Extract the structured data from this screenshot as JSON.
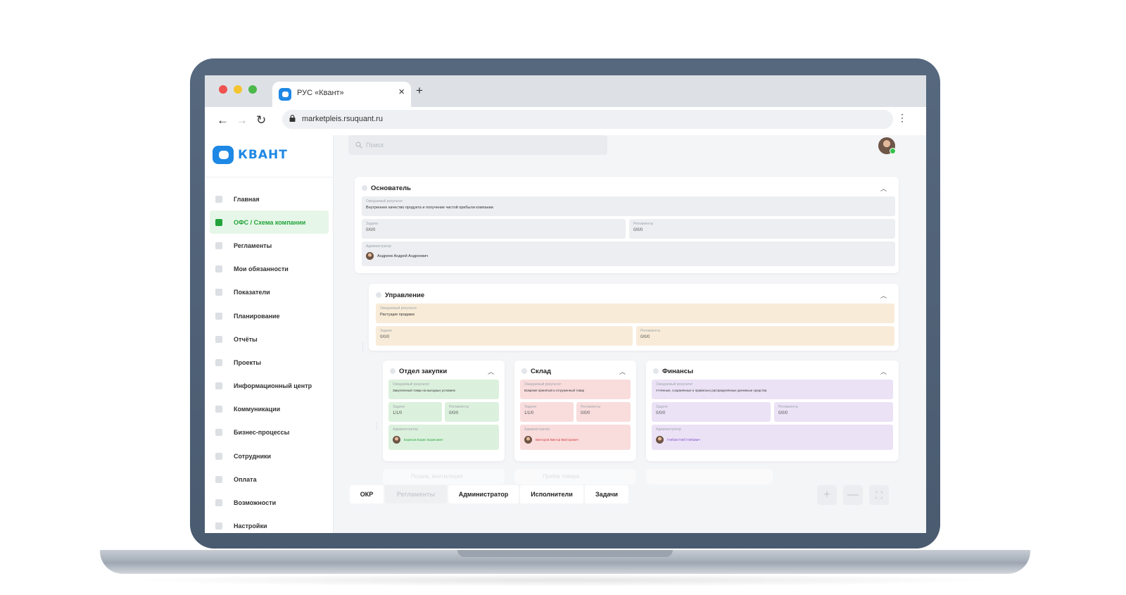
{
  "browser": {
    "tab_title": "РУС «Квант»",
    "tab_close": "×",
    "new_tab": "+",
    "url": "marketpleis.rsuquant.ru",
    "back": "←",
    "forward": "→",
    "reload": "↻",
    "menu": "⋮"
  },
  "app": {
    "logo_text": "КВАНТ",
    "search_placeholder": "Поиск"
  },
  "sidebar": {
    "items": [
      {
        "label": "Главная",
        "icon": "home-icon"
      },
      {
        "label": "ОФС / Схема компании",
        "icon": "structure-icon"
      },
      {
        "label": "Регламенты",
        "icon": "document-icon"
      },
      {
        "label": "Мои обязанности",
        "icon": "duties-icon"
      },
      {
        "label": "Показатели",
        "icon": "metrics-icon"
      },
      {
        "label": "Планирование",
        "icon": "planning-icon"
      },
      {
        "label": "Отчёты",
        "icon": "reports-icon"
      },
      {
        "label": "Проекты",
        "icon": "projects-icon"
      },
      {
        "label": "Информационный центр",
        "icon": "info-icon"
      },
      {
        "label": "Коммуникации",
        "icon": "chat-icon"
      },
      {
        "label": "Бизнес-процессы",
        "icon": "process-icon"
      },
      {
        "label": "Сотрудники",
        "icon": "people-icon"
      },
      {
        "label": "Оплата",
        "icon": "payment-icon"
      },
      {
        "label": "Возможности",
        "icon": "flag-icon"
      },
      {
        "label": "Настройки",
        "icon": "gear-icon"
      }
    ]
  },
  "org": {
    "founder": {
      "title": "Основатель",
      "result_label": "Ожидаемый результат",
      "result_text": "Внутреннее качество продукта и получение чистой прибыли компании",
      "tasks_label": "Задачи",
      "tasks_value": "0/0/0",
      "regs_label": "Регламенты",
      "regs_value": "0/0/0",
      "admin_label": "Администратор",
      "admin_name": "Андреев Андрей Андреевич"
    },
    "management": {
      "title": "Управление",
      "result_label": "Ожидаемый результат",
      "result_text": "Растущие продажи",
      "tasks_label": "Задачи",
      "tasks_value": "0/0/0",
      "regs_label": "Регламенты",
      "regs_value": "0/0/0"
    },
    "purchasing": {
      "title": "Отдел закупки",
      "result_label": "Ожидаемый результат",
      "result_text": "Закупленный товар на выгодных условиях",
      "tasks_label": "Задачи",
      "tasks_value": "1/1/0",
      "regs_label": "Регламенты",
      "regs_value": "0/0/0",
      "admin_label": "Администратор",
      "admin_name": "Борисов Борис Борисович"
    },
    "warehouse": {
      "title": "Склад",
      "result_label": "Ожидаемый результат",
      "result_text": "Вовремя принятый и отгруженный товар",
      "tasks_label": "Задачи",
      "tasks_value": "1/1/0",
      "regs_label": "Регламенты",
      "regs_value": "0/0/0",
      "admin_label": "Администратор",
      "admin_name": "Викторов Виктор Викторович"
    },
    "finance": {
      "title": "Финансы",
      "result_label": "Ожидаемый результат",
      "result_text": "Учтённые, сохранённые и правильно распределённые денежные средства",
      "tasks_label": "Задачи",
      "tasks_value": "0/0/0",
      "regs_label": "Регламенты",
      "regs_value": "0/0/0",
      "admin_label": "Администратор",
      "admin_name": "Глебов Глеб Глебович"
    },
    "ghosts": [
      "Пошив, вентиляция",
      "Приём товара",
      ""
    ]
  },
  "toolbar": {
    "modes": [
      "ОКР",
      "Регламенты",
      "Администратор",
      "Исполнители",
      "Задачи"
    ],
    "zoom_in": "+",
    "zoom_out": "—",
    "fullscreen": "⛶"
  },
  "colors": {
    "brand": "#1e88e5",
    "active_green": "#22a33a",
    "management": "#f8ecd8",
    "purchasing": "#dcf1dd",
    "warehouse": "#f9dcdc",
    "finance": "#ebe2f6"
  }
}
